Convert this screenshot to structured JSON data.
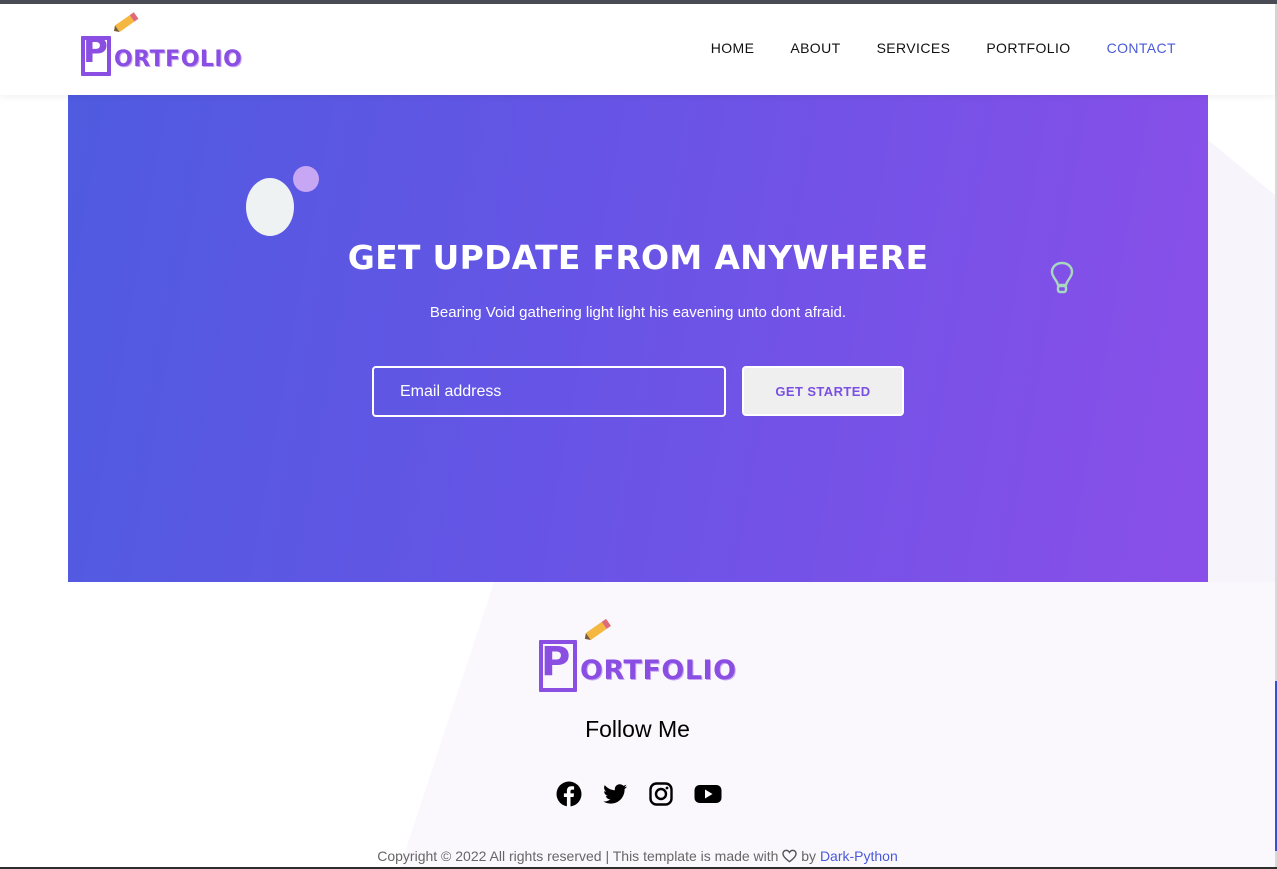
{
  "brand": {
    "logo_letter": "P",
    "logo_rest": "ORTFOLIO"
  },
  "nav": {
    "items": [
      {
        "label": "HOME",
        "active": false
      },
      {
        "label": "ABOUT",
        "active": false
      },
      {
        "label": "SERVICES",
        "active": false
      },
      {
        "label": "PORTFOLIO",
        "active": false
      },
      {
        "label": "CONTACT",
        "active": true
      }
    ]
  },
  "hero": {
    "title": "GET UPDATE FROM ANYWHERE",
    "subtitle": "Bearing Void gathering light light his eavening unto dont afraid.",
    "email_placeholder": "Email address",
    "cta_label": "GET STARTED"
  },
  "footer": {
    "heading": "Follow Me",
    "socials": [
      "facebook-icon",
      "twitter-icon",
      "instagram-icon",
      "youtube-icon"
    ],
    "copyright_prefix": "Copyright © 2022 All rights reserved | This template is made with",
    "copyright_by": "by",
    "author_link": "Dark-Python"
  },
  "colors": {
    "accent": "#8a4fe2",
    "nav_active": "#4a5ad8",
    "hero_gradient_start": "#4f5be0",
    "hero_gradient_end": "#8a4fe9"
  }
}
